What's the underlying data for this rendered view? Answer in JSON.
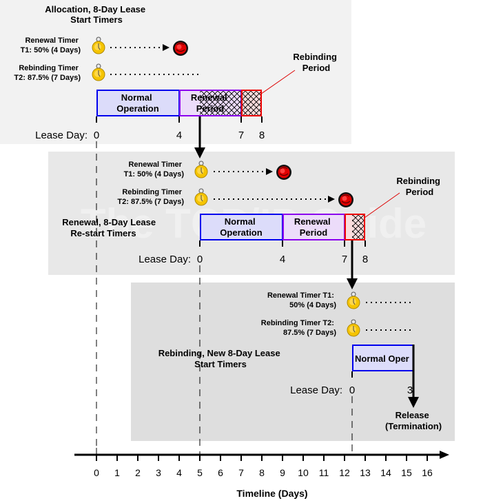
{
  "watermark": "The TCP/IP Guide",
  "colors": {
    "panel1_bg": "#f2f2f2",
    "panel2_bg": "#e8e8e8",
    "panel3_bg": "#dedede",
    "normal_border": "#0000ee",
    "normal_fill": "#dcdcfa",
    "renewal_border": "#8a00ee",
    "renewal_fill": "#ecdcfa",
    "rebinding_border": "#ee0000",
    "rebinding_fill": "#fadcdc",
    "timer_yellow": "#f5c400",
    "alarm_red": "#e00000",
    "leader_red": "#dd0000"
  },
  "panels": [
    {
      "title_line1": "Allocation, 8-Day Lease",
      "title_line2": "Start Timers",
      "lease_start_day": 0,
      "renewal_timer": {
        "line1": "Renewal Timer",
        "line2": "T1: 50% (4 Days)",
        "expired": true
      },
      "rebinding_timer": {
        "line1": "Rebinding Timer",
        "line2": "T2: 87.5% (7 Days)",
        "expired": false
      },
      "segments": [
        {
          "line1": "Normal",
          "line2": "Operation",
          "from": 0,
          "to": 4,
          "kind": "normal"
        },
        {
          "line1": "Renewal",
          "line2": "Period",
          "from": 4,
          "to": 7,
          "kind": "renewal",
          "hatch_from": 5
        },
        {
          "line1": "",
          "line2": "",
          "from": 7,
          "to": 8,
          "kind": "rebinding"
        }
      ],
      "callout": {
        "line1": "Rebinding",
        "line2": "Period"
      },
      "lease_day_label": "Lease Day:",
      "day_labels": [
        "0",
        "4",
        "7",
        "8"
      ],
      "transition_at_day": 5
    },
    {
      "title_line1": "Renewal, 8-Day Lease",
      "title_line2": "Re-start Timers",
      "lease_start_day": 5,
      "renewal_timer": {
        "line1": "Renewal Timer",
        "line2": "T1: 50% (4 Days)",
        "expired": true
      },
      "rebinding_timer": {
        "line1": "Rebinding Timer",
        "line2": "T2: 87.5% (7 Days)",
        "expired": true
      },
      "segments": [
        {
          "line1": "Normal",
          "line2": "Operation",
          "from": 0,
          "to": 4,
          "kind": "normal"
        },
        {
          "line1": "Renewal",
          "line2": "Period",
          "from": 4,
          "to": 7,
          "kind": "renewal"
        },
        {
          "line1": "",
          "line2": "",
          "from": 7,
          "to": 8,
          "kind": "rebinding",
          "hatch_from": 7.375
        }
      ],
      "callout": {
        "line1": "Rebinding",
        "line2": "Period"
      },
      "lease_day_label": "Lease Day:",
      "day_labels": [
        "0",
        "4",
        "7",
        "8"
      ],
      "transition_at_day": 12.375
    },
    {
      "title_line1": "Rebinding, New 8-Day Lease",
      "title_line2": "Start Timers",
      "lease_start_day": 12.375,
      "renewal_timer": {
        "line1": "Renewal Timer T1:",
        "line2": "50% (4 Days)",
        "expired": false
      },
      "rebinding_timer": {
        "line1": "Rebinding Timer T2:",
        "line2": "87.5% (7 Days)",
        "expired": false
      },
      "segments": [
        {
          "line1": "Normal Oper",
          "line2": "",
          "from": 0,
          "to": 3,
          "kind": "normal"
        }
      ],
      "lease_day_label": "Lease Day:",
      "day_labels": [
        "0",
        "3"
      ],
      "release": {
        "line1": "Release",
        "line2": "(Termination)"
      }
    }
  ],
  "timeline": {
    "title": "Timeline (Days)",
    "ticks": [
      "0",
      "1",
      "2",
      "3",
      "4",
      "5",
      "6",
      "7",
      "8",
      "9",
      "10",
      "11",
      "12",
      "13",
      "14",
      "15",
      "16"
    ]
  }
}
